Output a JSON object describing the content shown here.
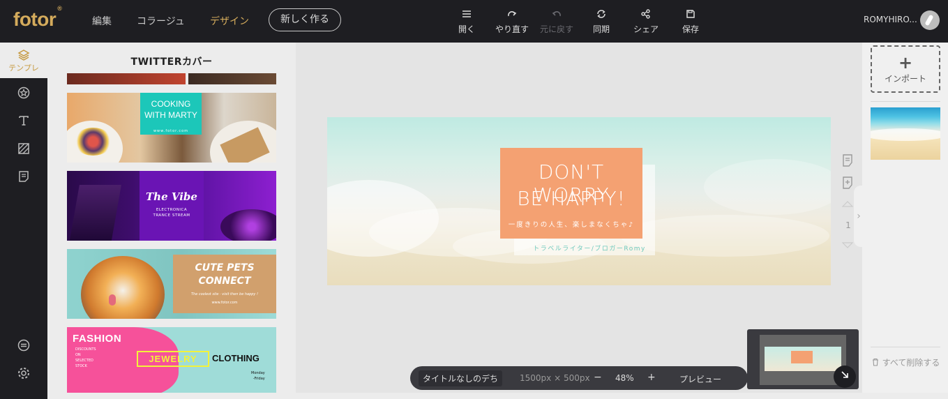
{
  "app": {
    "logo": "fotor",
    "logo_mark": "®"
  },
  "nav": {
    "edit": "編集",
    "collage": "コラージュ",
    "design": "デザイン",
    "new": "新しく作る"
  },
  "toolbar": [
    {
      "label": "開く",
      "icon": "menu-icon"
    },
    {
      "label": "やり直す",
      "icon": "redo-icon"
    },
    {
      "label": "元に戻す",
      "icon": "undo-icon",
      "disabled": true
    },
    {
      "label": "同期",
      "icon": "sync-icon"
    },
    {
      "label": "シェア",
      "icon": "share-icon"
    },
    {
      "label": "保存",
      "icon": "save-icon"
    }
  ],
  "user": {
    "name": "ROMYHIRO..."
  },
  "left_rail": {
    "templates_label": "テンプレ"
  },
  "template_panel": {
    "title": "TWITTERカバー",
    "cards": [
      {
        "title": "COOKING\nWITH MARTY",
        "sub": "www.fotor.com"
      },
      {
        "title": "The Vibe",
        "sub": "ELECTRONICA\nTRANCE STREAM"
      },
      {
        "title": "CUTE PETS\nCONNECT",
        "sub": "The coolest site · visit then be happy !",
        "url": "www.fotor.com"
      },
      {
        "title": "FASHION",
        "sub": "DISCOUNTS\nON\nSELECTED\nSTOCK",
        "mid": "JEWELRY",
        "right": "CLOTHING",
        "days": "Monday\n-Friday"
      }
    ]
  },
  "design": {
    "line1": "DON'T WORRY",
    "line2": "BE HAPPY!",
    "sub1": "一度きりの人生、楽しまなくちゃ♪",
    "sub2": "トラベルライター/ブロガーRomy",
    "accent": "#f4a172",
    "sub_color": "#6fc9bd"
  },
  "page_nav": {
    "page": "1"
  },
  "bottom_bar": {
    "title": "タイトルなしのデち",
    "size": "1500px × 500px",
    "zoom_out": "−",
    "zoom": "48%",
    "zoom_in": "+",
    "preview": "プレビュー"
  },
  "right_panel": {
    "import_plus": "+",
    "import_label": "インポート",
    "delete_all": "すべて削除する"
  }
}
